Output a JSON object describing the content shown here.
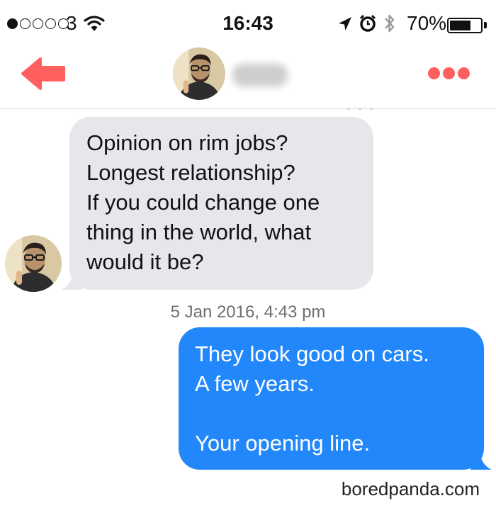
{
  "status_bar": {
    "carrier": "3",
    "signal_bars_filled": 1,
    "signal_bars_total": 5,
    "time": "16:43",
    "battery": "70%",
    "battery_level": 0.7,
    "icons": [
      "wifi-icon",
      "location-icon",
      "alarm-icon",
      "bluetooth-icon",
      "battery-icon"
    ]
  },
  "header": {
    "back_icon": "back-arrow-icon",
    "more_icon": "more-dots-icon",
    "accent_color": "#ff5f5f"
  },
  "conversation": {
    "incoming": {
      "lines": [
        "Opinion on rim jobs?",
        "Longest relationship?",
        "If you could change one",
        "thing in the world, what",
        "would it be?"
      ],
      "bubble_color": "#e6e6eb"
    },
    "timestamp": "5 Jan 2016, 4:43 pm",
    "outgoing": {
      "lines_top": [
        "They look good on cars.",
        "A few years."
      ],
      "lines_bottom": [
        "Your opening line."
      ],
      "bubble_color": "#2287fa"
    }
  },
  "watermark": "boredpanda.com"
}
